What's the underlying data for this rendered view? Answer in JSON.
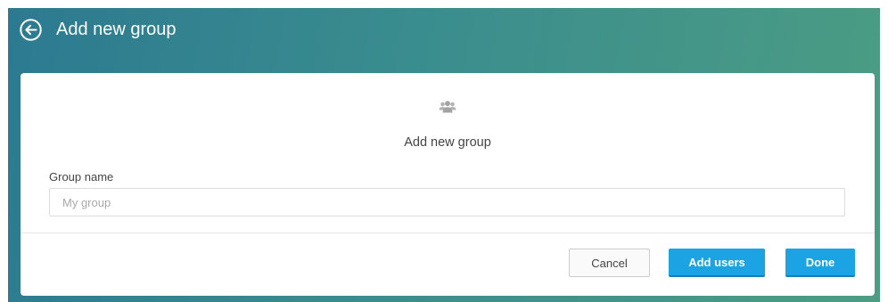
{
  "header": {
    "title": "Add new group",
    "back_icon": "arrow-left-circle-icon"
  },
  "card": {
    "icon": "users-group-icon",
    "title": "Add new group",
    "group_name": {
      "label": "Group name",
      "value": "",
      "placeholder": "My group"
    }
  },
  "actions": {
    "cancel_label": "Cancel",
    "add_users_label": "Add users",
    "done_label": "Done"
  },
  "colors": {
    "primary_button": "#1ba3e3",
    "header_gradient_start": "#2c7a91",
    "header_gradient_end": "#4c9d83"
  }
}
